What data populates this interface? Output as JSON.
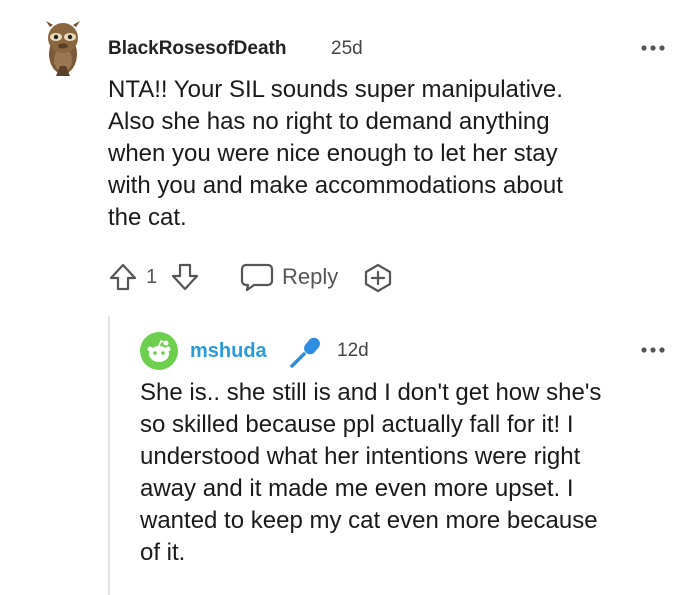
{
  "comment": {
    "username": "BlackRosesofDeath",
    "age": "25d",
    "more_icon": "more-dots-icon",
    "body": [
      "NTA!! Your SIL sounds super manipulative.",
      "Also she has no right to demand anything",
      "when you were nice enough to let her stay",
      "with you and make accommodations about",
      "the cat."
    ],
    "vote_count": "1",
    "reply_label": "Reply"
  },
  "reply": {
    "username": "mshuda",
    "age": "12d",
    "badge_icon": "microphone-icon",
    "more_icon": "more-dots-icon",
    "body": [
      "She is.. she still is and I don't get how she's",
      "so skilled because ppl actually fall for it! I",
      "understood what her intentions were right",
      "away and it made me even more upset. I",
      "wanted to keep my cat even more because",
      "of it."
    ]
  },
  "colors": {
    "username_link": "#2a9bd8",
    "avatar_green": "#6ccf4e",
    "mic_blue": "#2d8de0"
  }
}
